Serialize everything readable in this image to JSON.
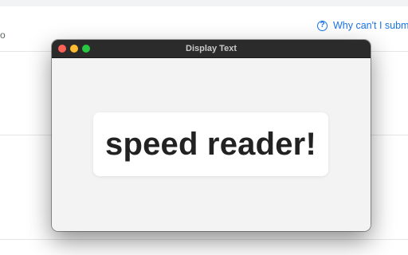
{
  "background": {
    "left_text": "o",
    "help_link": {
      "icon": "question-circle-icon",
      "icon_glyph": "?",
      "label": "Why can't I submi"
    }
  },
  "window": {
    "title": "Display Text",
    "buttons": {
      "close": "close-button",
      "minimize": "minimize-button",
      "zoom": "zoom-button"
    },
    "display_text": "speed reader!"
  },
  "colors": {
    "link": "#1a73e8",
    "titlebar": "#2b2b2b",
    "close": "#fe5f57",
    "minimize": "#febc2e",
    "zoom": "#28c840",
    "content_bg": "#f3f3f3",
    "card_bg": "#ffffff",
    "text": "#222222"
  }
}
